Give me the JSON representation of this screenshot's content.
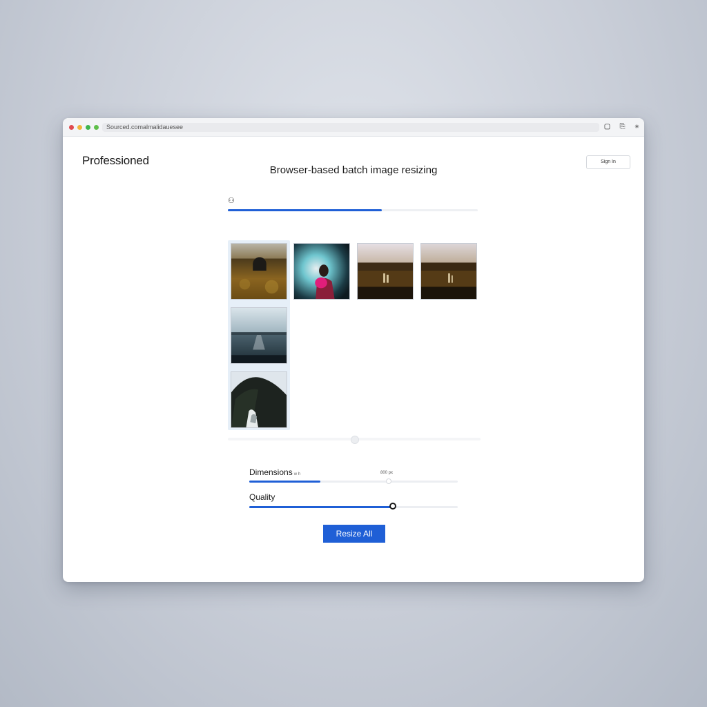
{
  "browser": {
    "url": "Sourced.comalmalidauesee",
    "traffic_lights": [
      "#e04a4f",
      "#f2b53a",
      "#3fb54d",
      "#5fbf4a"
    ]
  },
  "header": {
    "brand": "Professioned",
    "top_button_label": "Sign In",
    "subtitle": "Browser-based batch image resizing"
  },
  "progress": {
    "fraction": 0.615
  },
  "gallery": {
    "thumbnails": [
      {
        "id": "field-sunset",
        "selected": true
      },
      {
        "id": "teal-portrait",
        "selected": false
      },
      {
        "id": "field-figures-a",
        "selected": false
      },
      {
        "id": "field-figures-b",
        "selected": false
      },
      {
        "id": "lake-dusk",
        "selected": true
      },
      {
        "id": "mountain-forest",
        "selected": true
      }
    ],
    "scroll_fraction": 0.5
  },
  "controls": {
    "dimensions": {
      "label": "Dimensions",
      "sublabel": "w h",
      "value_text": "800 px",
      "fill_fraction": 0.34,
      "knob_fraction": 0.67
    },
    "quality": {
      "label": "Quality",
      "fill_fraction": 0.69
    }
  },
  "actions": {
    "resize_label": "Resize All"
  },
  "colors": {
    "accent": "#1f5fd6",
    "selection": "#e6eff8"
  }
}
